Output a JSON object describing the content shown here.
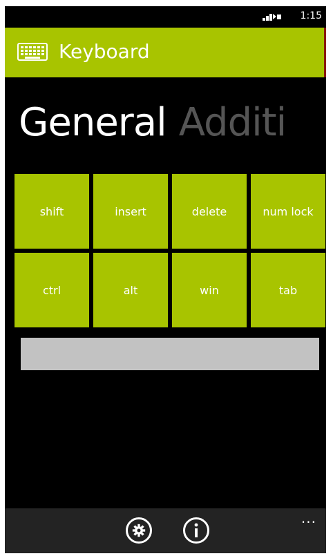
{
  "status_bar": {
    "time": "1:15",
    "signal_icon": "signal-icon"
  },
  "header": {
    "title": "Keyboard",
    "icon": "keyboard-icon",
    "accent_color": "#a8c400"
  },
  "pivot": {
    "active": "General",
    "inactive": "Additi"
  },
  "keys": [
    {
      "label": "shift"
    },
    {
      "label": "insert"
    },
    {
      "label": "delete"
    },
    {
      "label": "num lock"
    },
    {
      "label": "ctrl"
    },
    {
      "label": "alt"
    },
    {
      "label": "win"
    },
    {
      "label": "tab"
    }
  ],
  "text_input": {
    "value": "",
    "background": "#c2c2c2"
  },
  "app_bar": {
    "buttons": [
      {
        "icon": "settings-icon"
      },
      {
        "icon": "info-icon"
      }
    ],
    "more": "..."
  }
}
